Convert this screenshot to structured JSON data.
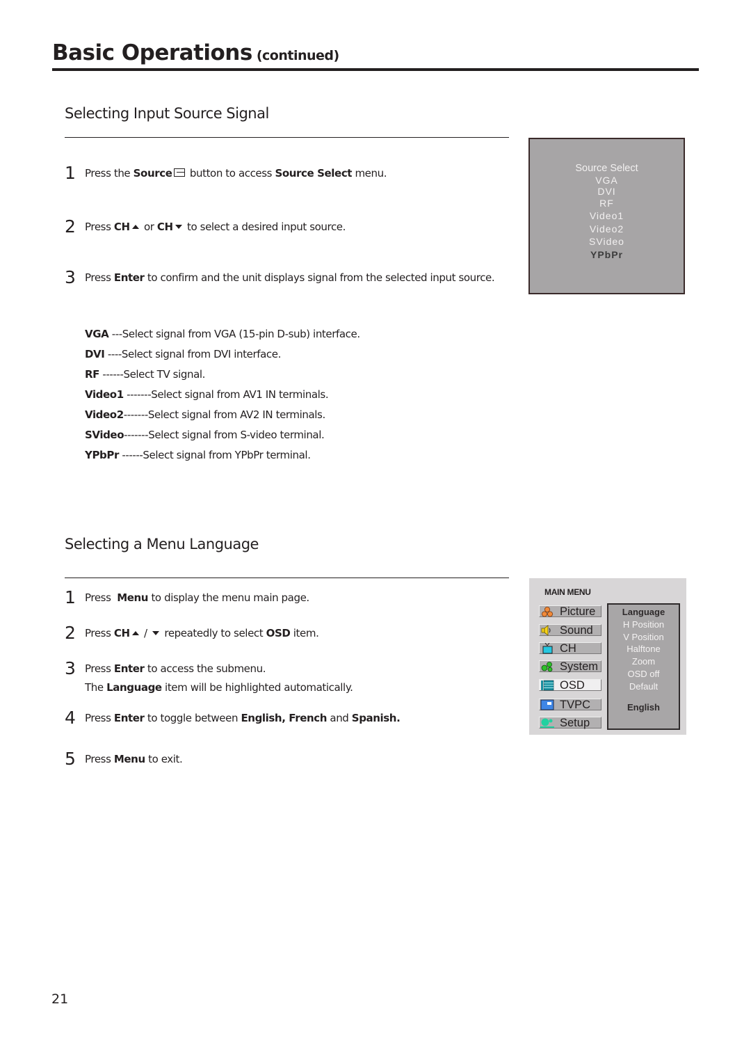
{
  "header": {
    "title": "Basic Operations",
    "subtitle": "(continued)"
  },
  "section_source": {
    "title": "Selecting Input Source Signal",
    "steps": [
      {
        "num": "1",
        "parts": [
          "Press the ",
          "Source",
          " button to access ",
          "Source Select",
          " menu."
        ],
        "icon": "source-input-icon"
      },
      {
        "num": "2",
        "parts": [
          "Press ",
          "CH",
          " or ",
          "CH",
          " to select a desired input source."
        ]
      },
      {
        "num": "3",
        "parts": [
          "Press ",
          "Enter",
          " to confirm and the unit displays signal from the selected input source."
        ]
      }
    ],
    "definitions": [
      {
        "term": "VGA",
        "desc": " ---Select signal from VGA (15-pin D-sub) interface."
      },
      {
        "term": "DVI",
        "desc": " ----Select signal from DVI interface."
      },
      {
        "term": "RF",
        "desc": " ------Select TV signal."
      },
      {
        "term": "Video1",
        "desc": " -------Select signal from AV1 IN terminals."
      },
      {
        "term": "Video2",
        "desc": "-------Select signal from AV2 IN terminals."
      },
      {
        "term": "SVideo",
        "desc": "-------Select signal from S-video terminal."
      },
      {
        "term": "YPbPr",
        "desc": " ------Select signal from YPbPr terminal."
      }
    ],
    "osd": {
      "header": "Source Select",
      "items": [
        "VGA",
        "DVI",
        "RF",
        "Video1",
        "Video2",
        "SVideo",
        "YPbPr"
      ],
      "selected": "YPbPr"
    }
  },
  "section_language": {
    "title": "Selecting a Menu Language",
    "steps": [
      {
        "num": "1",
        "parts": [
          "Press  ",
          "Menu",
          " to display the menu main page."
        ]
      },
      {
        "num": "2",
        "parts": [
          "Press ",
          "CH",
          " / ",
          "",
          " repeatedly to select ",
          "OSD",
          " item."
        ]
      },
      {
        "num": "3",
        "parts": [
          "Press ",
          "Enter",
          " to access the submenu."
        ],
        "continuation": [
          "The ",
          "Language",
          " item will be highlighted automatically."
        ]
      },
      {
        "num": "4",
        "parts": [
          "Press ",
          "Enter",
          " to toggle between ",
          "English, French",
          " and ",
          "Spanish."
        ]
      },
      {
        "num": "5",
        "parts": [
          "Press ",
          "Menu",
          " to exit."
        ]
      }
    ],
    "osd": {
      "title": "MAIN MENU",
      "menu_items": [
        {
          "label": "Picture",
          "icon": "picture-icon"
        },
        {
          "label": "Sound",
          "icon": "sound-icon"
        },
        {
          "label": "CH",
          "icon": "tv-channel-icon"
        },
        {
          "label": "System",
          "icon": "system-icon"
        },
        {
          "label": "OSD",
          "icon": "osd-icon",
          "active": true
        },
        {
          "label": "TVPC",
          "icon": "tvpc-icon"
        },
        {
          "label": "Setup",
          "icon": "setup-icon"
        }
      ],
      "submenu_items": [
        "Language",
        "H Position",
        "V Position",
        "Halftone",
        "Zoom",
        "OSD off",
        "Default"
      ],
      "submenu_selected": "Language",
      "submenu_value": "English"
    }
  },
  "footer": {
    "page_number": "21"
  },
  "colors": {
    "text": "#231f20",
    "osd_panel": "#a7a5a6",
    "osd_menu_bg": "#d8d6d7"
  }
}
